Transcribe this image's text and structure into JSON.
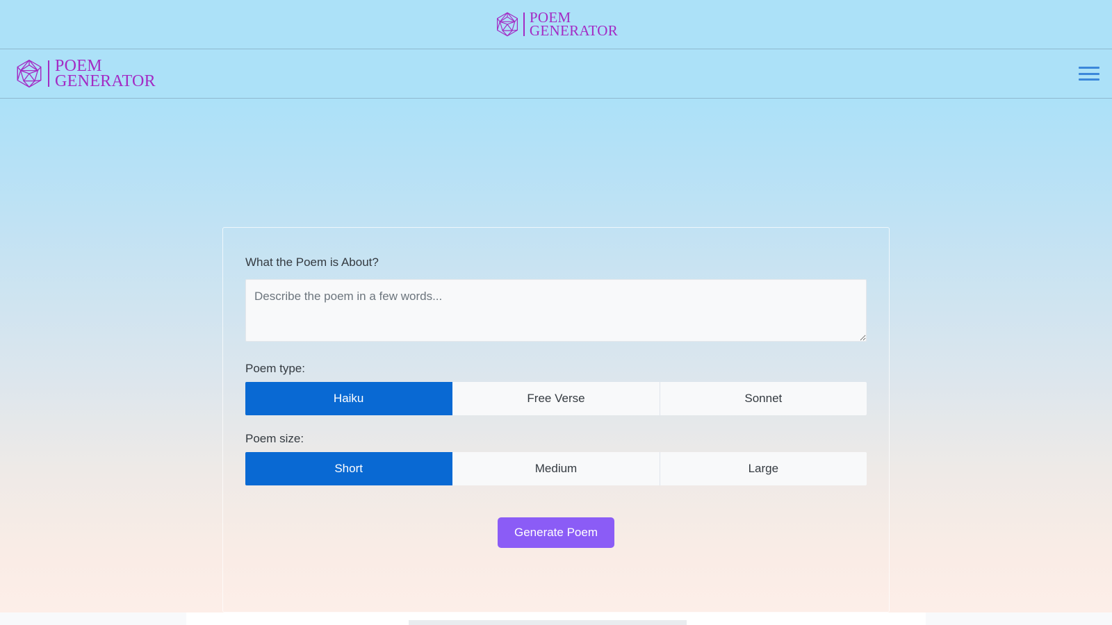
{
  "brand": {
    "icon": "icosahedron-icon",
    "line1": "POEM",
    "line2": "GENERATOR",
    "color": "#a32bc4"
  },
  "navbar": {
    "menu_icon": "hamburger-menu-icon",
    "menu_color": "#3b87da"
  },
  "form": {
    "prompt": {
      "label": "What the Poem is About?",
      "value": "",
      "placeholder": "Describe the poem in a few words..."
    },
    "poem_type": {
      "label": "Poem type:",
      "options": [
        {
          "label": "Haiku",
          "selected": true
        },
        {
          "label": "Free Verse",
          "selected": false
        },
        {
          "label": "Sonnet",
          "selected": false
        }
      ]
    },
    "poem_size": {
      "label": "Poem size:",
      "options": [
        {
          "label": "Short",
          "selected": true
        },
        {
          "label": "Medium",
          "selected": false
        },
        {
          "label": "Large",
          "selected": false
        }
      ]
    },
    "submit": {
      "label": "Generate Poem",
      "color": "#8b5cf6"
    }
  },
  "theme": {
    "banner_bg": "#ace1f8",
    "gradient_top": "#ace1f8",
    "gradient_bottom": "#fdeee8",
    "active_blue": "#0969d3",
    "text": "#343a40",
    "field_bg": "#f8f9fa"
  }
}
